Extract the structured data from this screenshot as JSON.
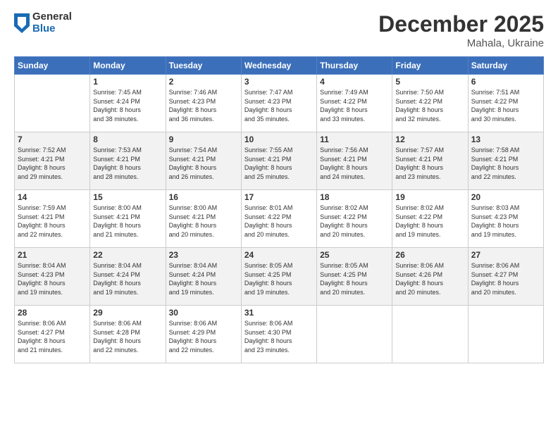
{
  "header": {
    "logo_general": "General",
    "logo_blue": "Blue",
    "month_title": "December 2025",
    "location": "Mahala, Ukraine"
  },
  "days_of_week": [
    "Sunday",
    "Monday",
    "Tuesday",
    "Wednesday",
    "Thursday",
    "Friday",
    "Saturday"
  ],
  "weeks": [
    [
      {
        "day": "",
        "info": ""
      },
      {
        "day": "1",
        "info": "Sunrise: 7:45 AM\nSunset: 4:24 PM\nDaylight: 8 hours\nand 38 minutes."
      },
      {
        "day": "2",
        "info": "Sunrise: 7:46 AM\nSunset: 4:23 PM\nDaylight: 8 hours\nand 36 minutes."
      },
      {
        "day": "3",
        "info": "Sunrise: 7:47 AM\nSunset: 4:23 PM\nDaylight: 8 hours\nand 35 minutes."
      },
      {
        "day": "4",
        "info": "Sunrise: 7:49 AM\nSunset: 4:22 PM\nDaylight: 8 hours\nand 33 minutes."
      },
      {
        "day": "5",
        "info": "Sunrise: 7:50 AM\nSunset: 4:22 PM\nDaylight: 8 hours\nand 32 minutes."
      },
      {
        "day": "6",
        "info": "Sunrise: 7:51 AM\nSunset: 4:22 PM\nDaylight: 8 hours\nand 30 minutes."
      }
    ],
    [
      {
        "day": "7",
        "info": "Sunrise: 7:52 AM\nSunset: 4:21 PM\nDaylight: 8 hours\nand 29 minutes."
      },
      {
        "day": "8",
        "info": "Sunrise: 7:53 AM\nSunset: 4:21 PM\nDaylight: 8 hours\nand 28 minutes."
      },
      {
        "day": "9",
        "info": "Sunrise: 7:54 AM\nSunset: 4:21 PM\nDaylight: 8 hours\nand 26 minutes."
      },
      {
        "day": "10",
        "info": "Sunrise: 7:55 AM\nSunset: 4:21 PM\nDaylight: 8 hours\nand 25 minutes."
      },
      {
        "day": "11",
        "info": "Sunrise: 7:56 AM\nSunset: 4:21 PM\nDaylight: 8 hours\nand 24 minutes."
      },
      {
        "day": "12",
        "info": "Sunrise: 7:57 AM\nSunset: 4:21 PM\nDaylight: 8 hours\nand 23 minutes."
      },
      {
        "day": "13",
        "info": "Sunrise: 7:58 AM\nSunset: 4:21 PM\nDaylight: 8 hours\nand 22 minutes."
      }
    ],
    [
      {
        "day": "14",
        "info": "Sunrise: 7:59 AM\nSunset: 4:21 PM\nDaylight: 8 hours\nand 22 minutes."
      },
      {
        "day": "15",
        "info": "Sunrise: 8:00 AM\nSunset: 4:21 PM\nDaylight: 8 hours\nand 21 minutes."
      },
      {
        "day": "16",
        "info": "Sunrise: 8:00 AM\nSunset: 4:21 PM\nDaylight: 8 hours\nand 20 minutes."
      },
      {
        "day": "17",
        "info": "Sunrise: 8:01 AM\nSunset: 4:22 PM\nDaylight: 8 hours\nand 20 minutes."
      },
      {
        "day": "18",
        "info": "Sunrise: 8:02 AM\nSunset: 4:22 PM\nDaylight: 8 hours\nand 20 minutes."
      },
      {
        "day": "19",
        "info": "Sunrise: 8:02 AM\nSunset: 4:22 PM\nDaylight: 8 hours\nand 19 minutes."
      },
      {
        "day": "20",
        "info": "Sunrise: 8:03 AM\nSunset: 4:23 PM\nDaylight: 8 hours\nand 19 minutes."
      }
    ],
    [
      {
        "day": "21",
        "info": "Sunrise: 8:04 AM\nSunset: 4:23 PM\nDaylight: 8 hours\nand 19 minutes."
      },
      {
        "day": "22",
        "info": "Sunrise: 8:04 AM\nSunset: 4:24 PM\nDaylight: 8 hours\nand 19 minutes."
      },
      {
        "day": "23",
        "info": "Sunrise: 8:04 AM\nSunset: 4:24 PM\nDaylight: 8 hours\nand 19 minutes."
      },
      {
        "day": "24",
        "info": "Sunrise: 8:05 AM\nSunset: 4:25 PM\nDaylight: 8 hours\nand 19 minutes."
      },
      {
        "day": "25",
        "info": "Sunrise: 8:05 AM\nSunset: 4:25 PM\nDaylight: 8 hours\nand 20 minutes."
      },
      {
        "day": "26",
        "info": "Sunrise: 8:06 AM\nSunset: 4:26 PM\nDaylight: 8 hours\nand 20 minutes."
      },
      {
        "day": "27",
        "info": "Sunrise: 8:06 AM\nSunset: 4:27 PM\nDaylight: 8 hours\nand 20 minutes."
      }
    ],
    [
      {
        "day": "28",
        "info": "Sunrise: 8:06 AM\nSunset: 4:27 PM\nDaylight: 8 hours\nand 21 minutes."
      },
      {
        "day": "29",
        "info": "Sunrise: 8:06 AM\nSunset: 4:28 PM\nDaylight: 8 hours\nand 22 minutes."
      },
      {
        "day": "30",
        "info": "Sunrise: 8:06 AM\nSunset: 4:29 PM\nDaylight: 8 hours\nand 22 minutes."
      },
      {
        "day": "31",
        "info": "Sunrise: 8:06 AM\nSunset: 4:30 PM\nDaylight: 8 hours\nand 23 minutes."
      },
      {
        "day": "",
        "info": ""
      },
      {
        "day": "",
        "info": ""
      },
      {
        "day": "",
        "info": ""
      }
    ]
  ]
}
